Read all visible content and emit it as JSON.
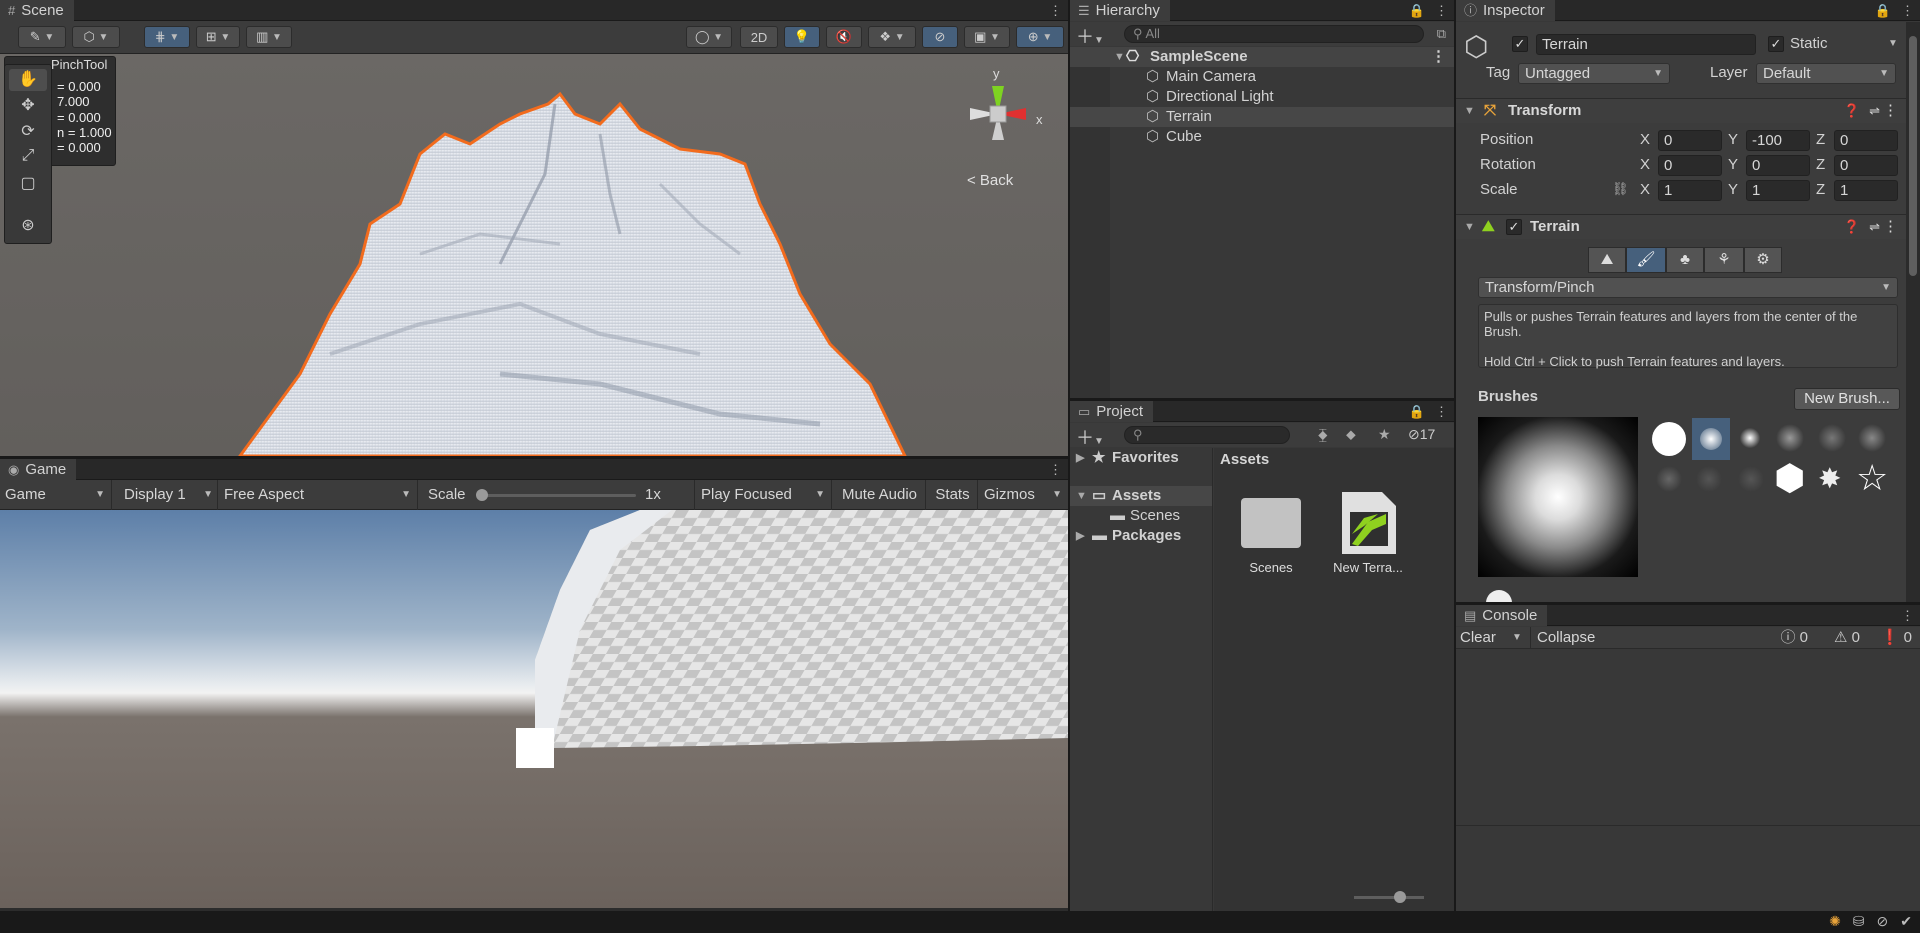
{
  "scene": {
    "tab": "Scene",
    "overlay_title": "PinchTool",
    "overlay_values": [
      "= 0.000",
      "7.000",
      "= 0.000",
      "n = 1.000",
      "= 0.000"
    ],
    "btn_2d": "2D",
    "back_label": "< Back",
    "gizmo_y": "y",
    "gizmo_x": "x"
  },
  "game": {
    "tab": "Game",
    "mode": "Game",
    "display": "Display 1",
    "aspect": "Free Aspect",
    "scale_label": "Scale",
    "scale_value": "1x",
    "play_focused": "Play Focused",
    "mute": "Mute Audio",
    "stats": "Stats",
    "gizmos": "Gizmos"
  },
  "hierarchy": {
    "tab": "Hierarchy",
    "search_placeholder": "All",
    "scene_name": "SampleScene",
    "items": [
      "Main Camera",
      "Directional Light",
      "Terrain",
      "Cube"
    ]
  },
  "project": {
    "tab": "Project",
    "hidden_count": "17",
    "favorites": "Favorites",
    "assets": "Assets",
    "scenes": "Scenes",
    "packages": "Packages",
    "breadcrumb": "Assets",
    "files": [
      "Scenes",
      "New Terra..."
    ]
  },
  "inspector": {
    "tab": "Inspector",
    "object_name": "Terrain",
    "static_label": "Static",
    "tag_label": "Tag",
    "tag_value": "Untagged",
    "layer_label": "Layer",
    "layer_value": "Default",
    "transform": {
      "title": "Transform",
      "position_label": "Position",
      "rotation_label": "Rotation",
      "scale_label": "Scale",
      "axis_x": "X",
      "axis_y": "Y",
      "axis_z": "Z",
      "position": [
        "0",
        "-100",
        "0"
      ],
      "rotation": [
        "0",
        "0",
        "0"
      ],
      "scale": [
        "1",
        "1",
        "1"
      ]
    },
    "terrain": {
      "title": "Terrain",
      "tool": "Transform/Pinch",
      "desc1": "Pulls or pushes Terrain features and layers from the center of the Brush.",
      "desc2": "Hold Ctrl + Click to push Terrain features and layers.",
      "brushes_label": "Brushes",
      "new_brush": "New Brush..."
    }
  },
  "console": {
    "tab": "Console",
    "clear": "Clear",
    "collapse": "Collapse",
    "info_count": "0",
    "warn_count": "0",
    "error_count": "0"
  },
  "colors": {
    "selection_orange": "#f26b1d",
    "active_blue": "#46607c",
    "terrain_green": "#8fd11f"
  }
}
